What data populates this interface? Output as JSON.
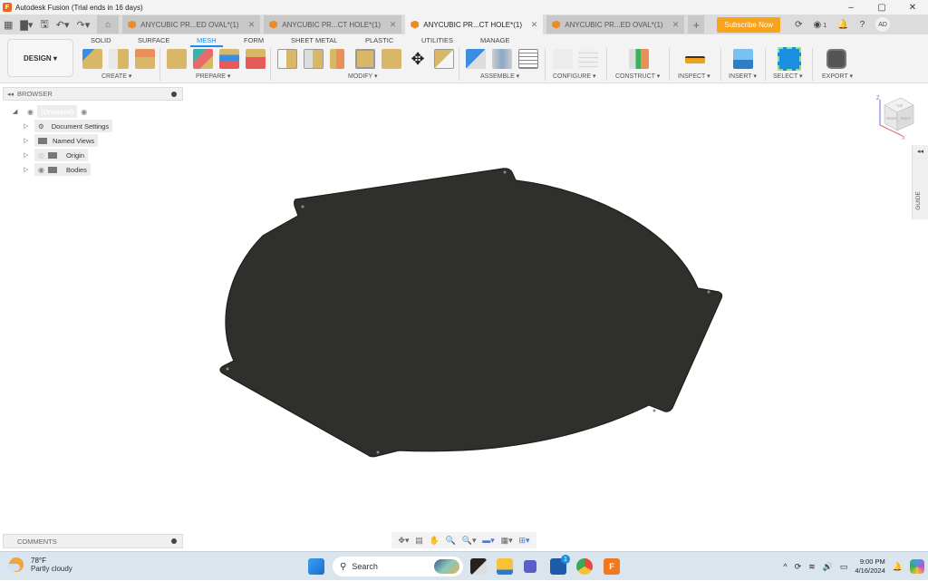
{
  "window": {
    "title": "Autodesk Fusion (Trial ends in 16 days)",
    "minimize": "–",
    "maximize": "▢",
    "close": "✕"
  },
  "tabs": {
    "items": [
      {
        "label": "ANYCUBIC PR...ED OVAL*(1)",
        "active": false
      },
      {
        "label": "ANYCUBIC PR...CT HOLE*(1)",
        "active": false
      },
      {
        "label": "ANYCUBIC PR...CT HOLE*(1)",
        "active": true
      },
      {
        "label": "ANYCUBIC PR...ED OVAL*(1)",
        "active": false
      }
    ],
    "close": "✕",
    "new_tab": "+",
    "subscribe": "Subscribe Now",
    "job_count": "1",
    "avatar": "AD"
  },
  "toolbar": {
    "workspace": "DESIGN ▾",
    "ws_tabs": [
      "SOLID",
      "SURFACE",
      "MESH",
      "FORM",
      "SHEET METAL",
      "PLASTIC",
      "UTILITIES",
      "MANAGE"
    ],
    "active_ws_tab": "MESH",
    "groups": [
      "CREATE ▾",
      "PREPARE ▾",
      "MODIFY ▾",
      "ASSEMBLE ▾",
      "CONFIGURE ▾",
      "CONSTRUCT ▾",
      "INSPECT ▾",
      "INSERT ▾",
      "SELECT ▾",
      "EXPORT ▾"
    ]
  },
  "browser": {
    "title": "BROWSER",
    "root": "(Unsaved)",
    "items": [
      "Document Settings",
      "Named Views",
      "Origin",
      "Bodies"
    ]
  },
  "viewcube": {
    "faces": [
      "TOP",
      "FRONT",
      "RIGHT"
    ],
    "axes": [
      "Z",
      "X"
    ]
  },
  "guide": {
    "label": "GUIDE"
  },
  "comments": {
    "title": "COMMENTS"
  },
  "taskbar": {
    "temp": "78°F",
    "condition": "Partly cloudy",
    "search": "Search",
    "time": "9:00 PM",
    "date": "4/16/2024",
    "store_badge": "1"
  }
}
